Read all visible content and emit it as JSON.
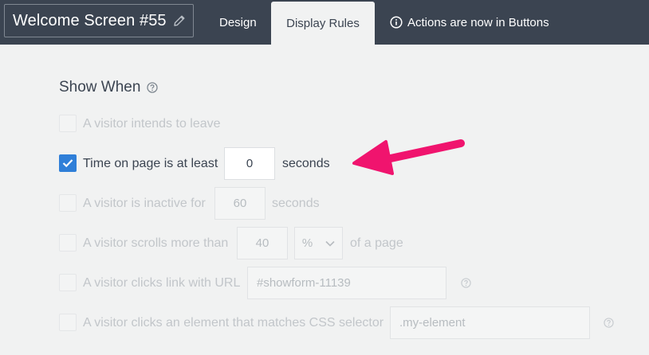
{
  "header": {
    "title": "Welcome Screen #55",
    "tabs": [
      {
        "label": "Design"
      },
      {
        "label": "Display Rules"
      },
      {
        "label": "Actions are now in Buttons"
      }
    ]
  },
  "section": {
    "title": "Show When"
  },
  "rules": [
    {
      "label": "A visitor intends to leave",
      "checked": false
    },
    {
      "label": "Time on page is at least",
      "checked": true,
      "value": "0",
      "suffix": "seconds"
    },
    {
      "label": "A visitor is inactive for",
      "checked": false,
      "value": "60",
      "suffix": "seconds"
    },
    {
      "label": "A visitor scrolls more than",
      "checked": false,
      "value": "40",
      "unit": "%",
      "suffix": "of a page"
    },
    {
      "label": "A visitor clicks link with URL",
      "checked": false,
      "placeholder": "#showform-11139"
    },
    {
      "label": "A visitor clicks an element that matches CSS selector",
      "checked": false,
      "placeholder": ".my-element"
    }
  ],
  "colors": {
    "header_bg": "#3b4451",
    "accent": "#2f7fd8",
    "arrow": "#f0146e"
  }
}
